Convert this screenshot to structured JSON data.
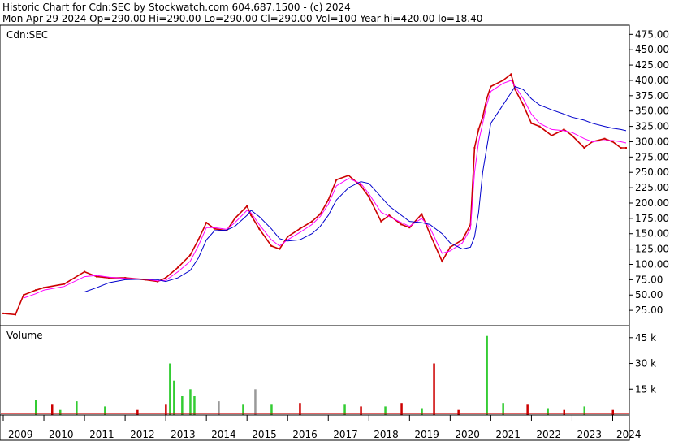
{
  "header": {
    "line1": "Historic Chart for Cdn:SEC by Stockwatch.com 604.687.1500 - (c) 2024",
    "line2": "Mon Apr 29 2024   Op=290.00   Hi=290.00   Lo=290.00   Cl=290.00   Vol=100   Year hi=420.00   lo=18.40"
  },
  "colors": {
    "price": "#cc0000",
    "price_up": "#000000",
    "ma_short": "#ff00ff",
    "ma_long": "#0000cc",
    "vol_up": "#33cc33",
    "vol_down": "#cc0000",
    "vol_neutral": "#999999"
  },
  "chart_data": [
    {
      "type": "line",
      "title": "Cdn:SEC",
      "xlabel": "",
      "ylabel": "",
      "ylim": [
        0,
        490
      ],
      "y_ticks": [
        25,
        50,
        75,
        100,
        125,
        150,
        175,
        200,
        225,
        250,
        275,
        300,
        325,
        350,
        375,
        400,
        425,
        450,
        475
      ],
      "y_tick_labels": [
        "25.00",
        "50.00",
        "75.00",
        "100.00",
        "125.00",
        "150.00",
        "175.00",
        "200.00",
        "225.00",
        "250.00",
        "275.00",
        "300.00",
        "325.00",
        "350.00",
        "375.00",
        "400.00",
        "425.00",
        "450.00",
        "475.00"
      ],
      "grid": false,
      "x": [
        2009.0,
        2009.3,
        2009.5,
        2009.8,
        2010.0,
        2010.5,
        2011.0,
        2011.3,
        2011.6,
        2012.0,
        2012.5,
        2012.8,
        2013.0,
        2013.3,
        2013.6,
        2013.8,
        2014.0,
        2014.2,
        2014.5,
        2014.7,
        2015.0,
        2015.1,
        2015.3,
        2015.6,
        2015.8,
        2016.0,
        2016.3,
        2016.6,
        2016.8,
        2017.0,
        2017.2,
        2017.5,
        2017.8,
        2018.0,
        2018.3,
        2018.5,
        2018.8,
        2019.0,
        2019.3,
        2019.5,
        2019.8,
        2020.0,
        2020.3,
        2020.5,
        2020.6,
        2020.7,
        2020.8,
        2020.9,
        2021.0,
        2021.3,
        2021.5,
        2021.6,
        2021.8,
        2022.0,
        2022.2,
        2022.5,
        2022.8,
        2023.0,
        2023.3,
        2023.5,
        2023.8,
        2024.0,
        2024.2,
        2024.33
      ],
      "series": [
        {
          "name": "Close",
          "values": [
            20,
            18,
            50,
            58,
            62,
            68,
            88,
            80,
            78,
            78,
            75,
            72,
            78,
            95,
            115,
            140,
            168,
            158,
            155,
            175,
            195,
            180,
            158,
            130,
            125,
            145,
            158,
            170,
            182,
            205,
            238,
            245,
            228,
            210,
            170,
            180,
            165,
            160,
            182,
            150,
            105,
            128,
            140,
            165,
            290,
            320,
            340,
            370,
            390,
            400,
            410,
            385,
            360,
            330,
            325,
            310,
            320,
            310,
            290,
            300,
            305,
            300,
            290,
            290
          ]
        },
        {
          "name": "Short MA",
          "values": [
            null,
            null,
            45,
            52,
            58,
            64,
            80,
            82,
            79,
            77,
            76,
            73,
            74,
            88,
            105,
            130,
            160,
            160,
            157,
            168,
            188,
            184,
            165,
            140,
            130,
            140,
            152,
            165,
            178,
            198,
            228,
            240,
            232,
            215,
            185,
            178,
            168,
            162,
            175,
            160,
            118,
            122,
            135,
            158,
            250,
            300,
            330,
            360,
            382,
            395,
            400,
            390,
            370,
            345,
            330,
            320,
            318,
            315,
            305,
            300,
            302,
            302,
            300,
            298
          ]
        },
        {
          "name": "Long MA",
          "values": [
            null,
            null,
            null,
            null,
            null,
            null,
            55,
            62,
            70,
            75,
            76,
            75,
            72,
            78,
            90,
            110,
            140,
            155,
            156,
            162,
            180,
            188,
            178,
            158,
            142,
            138,
            140,
            150,
            162,
            180,
            205,
            225,
            235,
            232,
            210,
            195,
            180,
            170,
            168,
            165,
            150,
            135,
            125,
            128,
            145,
            185,
            250,
            290,
            330,
            360,
            380,
            390,
            385,
            370,
            360,
            352,
            345,
            340,
            335,
            330,
            325,
            322,
            320,
            318
          ]
        }
      ]
    },
    {
      "type": "bar",
      "title": "Volume",
      "y_ticks": [
        15000,
        30000,
        45000
      ],
      "y_tick_labels": [
        "15 k",
        "30 k",
        "45 k"
      ],
      "ylim": [
        0,
        52000
      ],
      "x": [
        2009.8,
        2010.2,
        2010.4,
        2010.8,
        2011.5,
        2012.3,
        2013.0,
        2013.1,
        2013.2,
        2013.4,
        2013.6,
        2013.7,
        2014.3,
        2014.9,
        2015.2,
        2015.6,
        2016.3,
        2017.4,
        2017.8,
        2018.4,
        2018.8,
        2019.3,
        2019.6,
        2020.2,
        2020.9,
        2021.3,
        2021.9,
        2022.4,
        2022.8,
        2023.3,
        2024.0
      ],
      "values": [
        9000,
        6000,
        3000,
        8000,
        5000,
        3000,
        6000,
        30000,
        20000,
        11000,
        15000,
        11000,
        8000,
        6000,
        15000,
        6000,
        7000,
        6000,
        5000,
        5000,
        7000,
        4000,
        30000,
        3000,
        46000,
        7000,
        6000,
        4000,
        3000,
        5000,
        3000
      ],
      "colors": [
        "up",
        "down",
        "up",
        "up",
        "up",
        "down",
        "down",
        "up",
        "up",
        "up",
        "up",
        "up",
        "neutral",
        "up",
        "neutral",
        "up",
        "down",
        "up",
        "down",
        "up",
        "down",
        "up",
        "down",
        "down",
        "up",
        "up",
        "down",
        "up",
        "down",
        "up",
        "down"
      ]
    }
  ],
  "x_axis": {
    "labels": [
      "2009",
      "2010",
      "2011",
      "2012",
      "2013",
      "2014",
      "2015",
      "2016",
      "2017",
      "2018",
      "2019",
      "2020",
      "2021",
      "2022",
      "2023",
      "2024"
    ]
  }
}
